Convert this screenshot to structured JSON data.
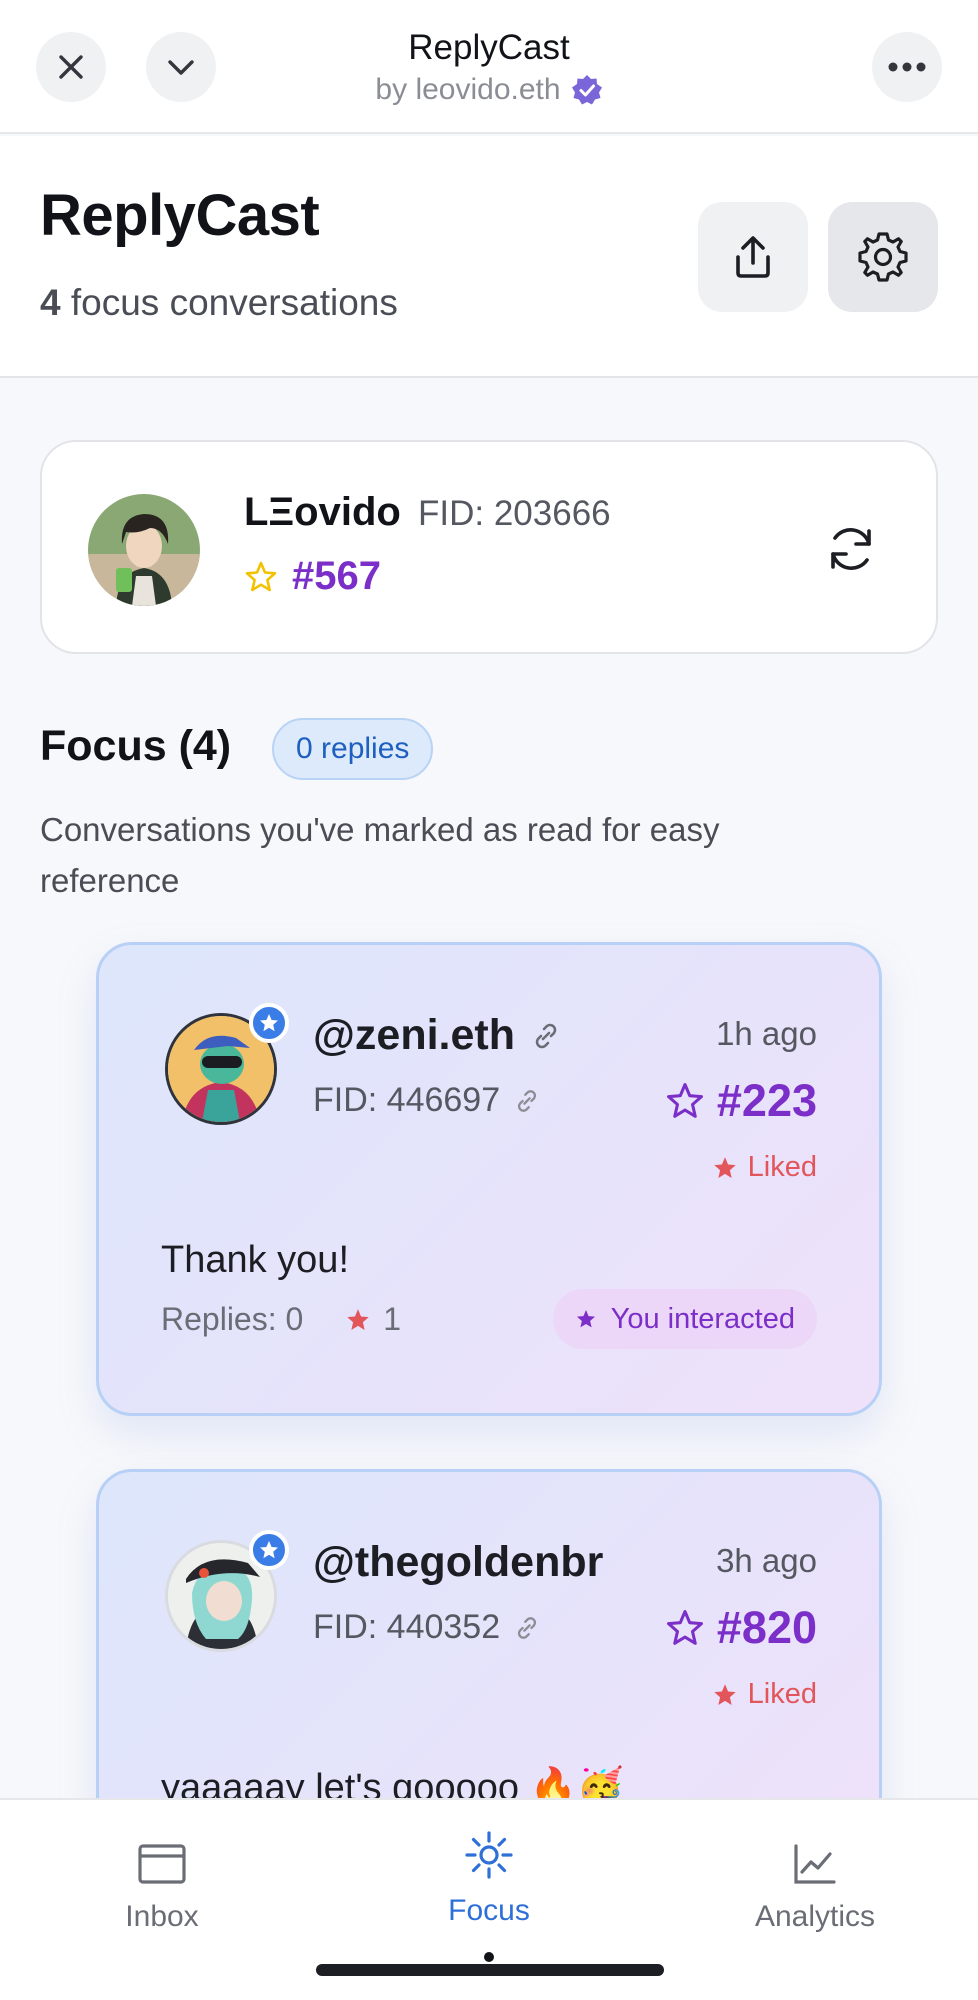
{
  "topbar": {
    "app_title": "ReplyCast",
    "byline": "by leovido.eth",
    "icons": {
      "close": "close-icon",
      "collapse": "chevron-down-icon",
      "more": "more-horizontal-icon",
      "verified": "verified-badge-icon"
    }
  },
  "header": {
    "title": "ReplyCast",
    "count": "4",
    "count_suffix": "focus conversations",
    "icons": {
      "share": "share-icon",
      "settings": "gear-icon"
    }
  },
  "profile": {
    "name": "LΞovido",
    "fid": "FID: 203666",
    "rank": "#567",
    "icons": {
      "rank": "star-outline-icon",
      "refresh": "refresh-icon"
    }
  },
  "focus": {
    "title": "Focus (4)",
    "replies_badge": "0 replies",
    "description": "Conversations you've marked as read for easy reference"
  },
  "conversations": [
    {
      "handle": "@zeni.eth",
      "fid": "FID: 446697",
      "time": "1h ago",
      "rank": "#223",
      "liked": "Liked",
      "text": "Thank you!",
      "replies": "Replies: 0",
      "likes": "1",
      "interacted": "You interacted"
    },
    {
      "handle": "@thegoldenbr",
      "fid": "FID: 440352",
      "time": "3h ago",
      "rank": "#820",
      "liked": "Liked",
      "text": "yaaaaay let's gooooo 🔥🥳"
    }
  ],
  "nav": {
    "items": [
      {
        "label": "Inbox",
        "icon": "inbox-icon"
      },
      {
        "label": "Focus",
        "icon": "focus-icon",
        "active": true
      },
      {
        "label": "Analytics",
        "icon": "analytics-icon"
      }
    ]
  },
  "colors": {
    "accent_purple": "#7b2fc8",
    "accent_blue": "#1f5fbf",
    "liked_red": "#e2555b",
    "star_yellow": "#f2c200"
  }
}
